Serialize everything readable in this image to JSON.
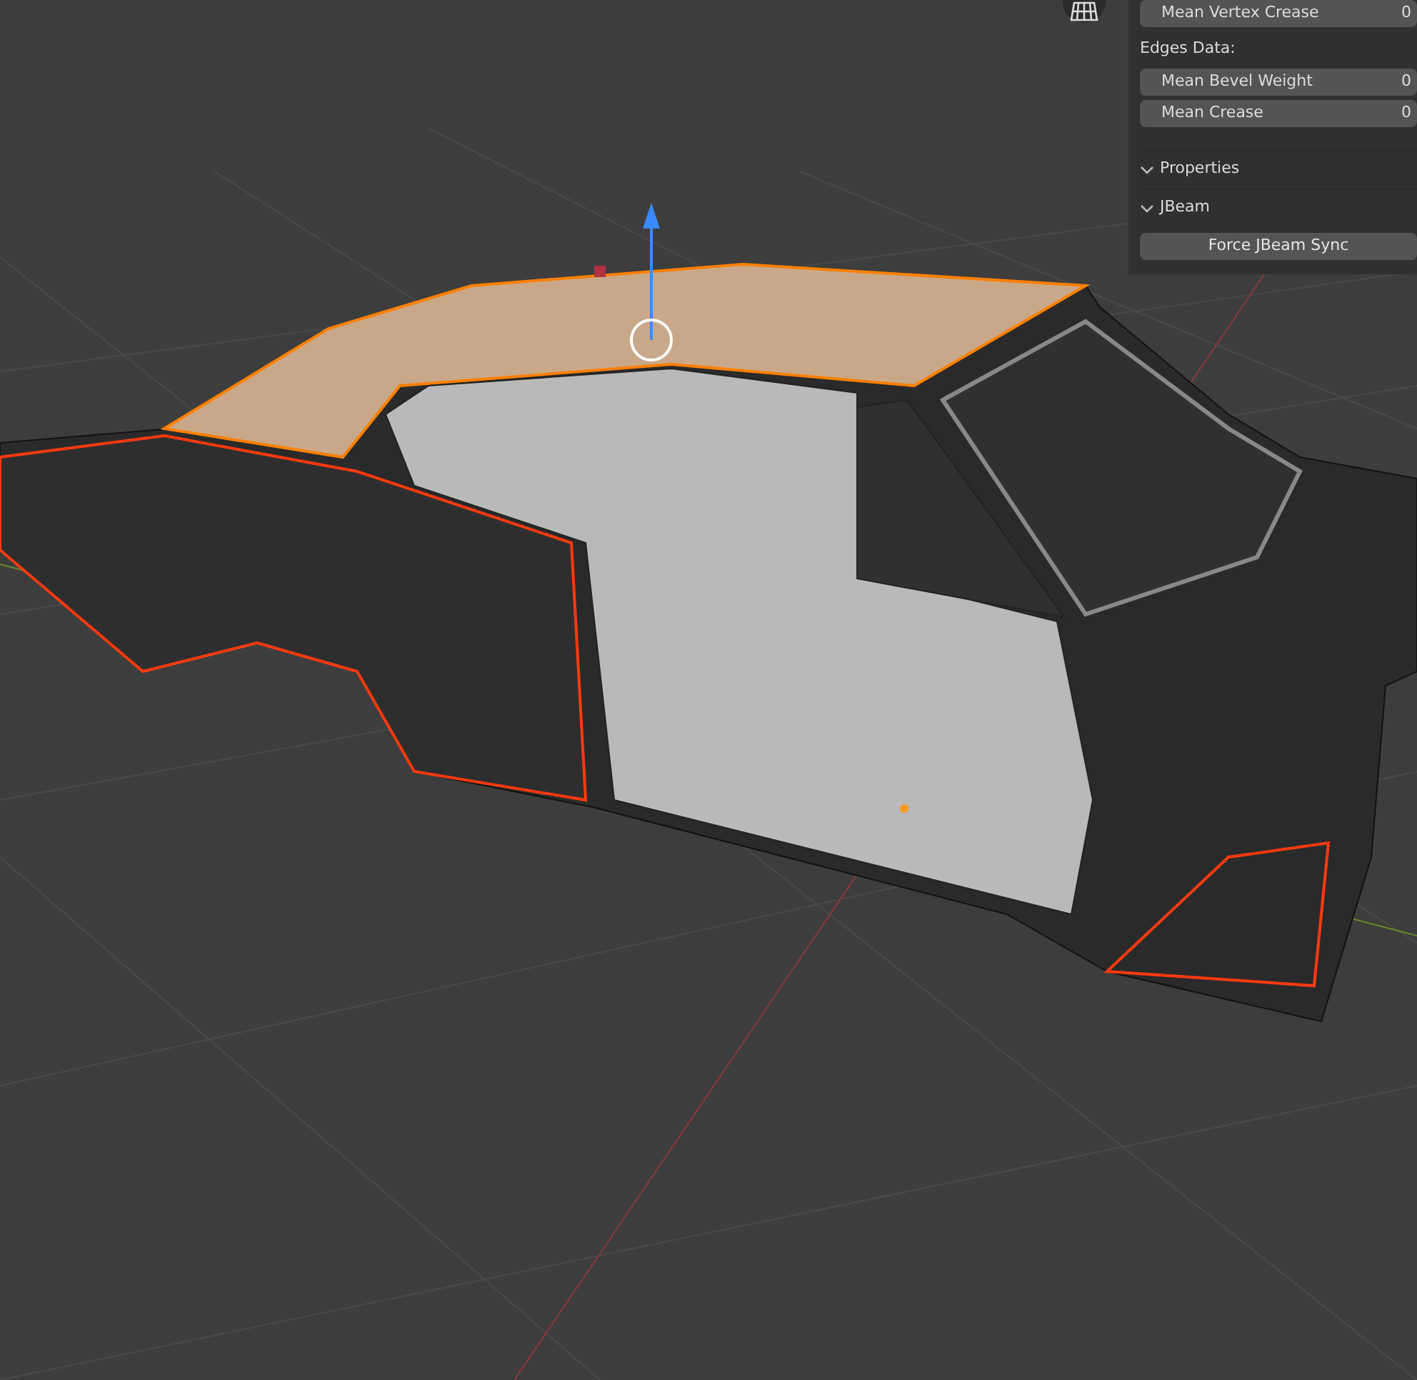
{
  "sidebar": {
    "rows_top": [
      {
        "label": "Mean Vertex Crease",
        "value": "0"
      }
    ],
    "edges_heading": "Edges Data:",
    "edge_rows": [
      {
        "label": "Mean Bevel Weight",
        "value": "0"
      },
      {
        "label": "Mean Crease",
        "value": "0"
      }
    ],
    "sections": [
      {
        "label": "Properties",
        "expanded": true
      },
      {
        "label": "JBeam",
        "expanded": true
      }
    ],
    "button": "Force JBeam Sync"
  }
}
